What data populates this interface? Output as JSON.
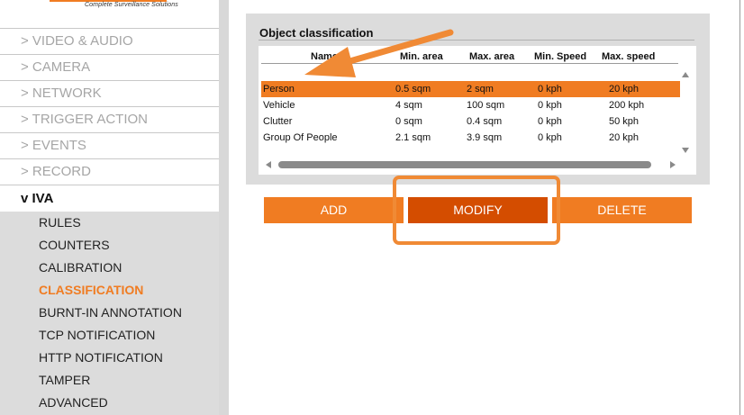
{
  "logo": {
    "tagline": "Complete Surveillance Solutions"
  },
  "menu": [
    {
      "label": "> VIDEO & AUDIO"
    },
    {
      "label": "> CAMERA"
    },
    {
      "label": "> NETWORK"
    },
    {
      "label": "> TRIGGER ACTION"
    },
    {
      "label": "> EVENTS"
    },
    {
      "label": "> RECORD"
    },
    {
      "label": "v IVA"
    }
  ],
  "submenu": [
    {
      "label": "RULES"
    },
    {
      "label": "COUNTERS"
    },
    {
      "label": "CALIBRATION"
    },
    {
      "label": "CLASSIFICATION"
    },
    {
      "label": "BURNT-IN ANNOTATION"
    },
    {
      "label": "TCP NOTIFICATION"
    },
    {
      "label": "HTTP NOTIFICATION"
    },
    {
      "label": "TAMPER"
    },
    {
      "label": "ADVANCED"
    }
  ],
  "panel": {
    "title": "Object classification",
    "columns": [
      "Name",
      "Min. area",
      "Max. area",
      "Min. Speed",
      "Max. speed"
    ],
    "rows": [
      [
        "Person",
        "0.5 sqm",
        "2 sqm",
        "0 kph",
        "20 kph"
      ],
      [
        "Vehicle",
        "4 sqm",
        "100 sqm",
        "0 kph",
        "200 kph"
      ],
      [
        "Clutter",
        "0 sqm",
        "0.4 sqm",
        "0 kph",
        "50 kph"
      ],
      [
        "Group Of People",
        "2.1 sqm",
        "3.9 sqm",
        "0 kph",
        "20 kph"
      ]
    ]
  },
  "buttons": {
    "add": "ADD",
    "modify": "MODIFY",
    "delete": "DELETE"
  },
  "icons": {
    "scroll_up": "triangle-up-icon",
    "scroll_down": "triangle-down-icon",
    "scroll_left": "triangle-left-icon",
    "scroll_right": "triangle-right-icon",
    "annotation_arrow": "arrow-icon"
  },
  "colors": {
    "accent": "#f07c22",
    "button_pressed": "#d44d00",
    "menu_inactive": "#a6a6a6",
    "submenu_bg": "#dcdcdc"
  }
}
